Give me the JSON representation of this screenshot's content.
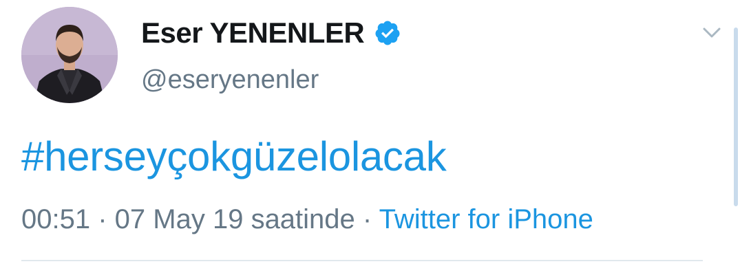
{
  "tweet": {
    "author": {
      "display_name": "Eser YENENLER",
      "handle": "@eseryenenler",
      "verified": true
    },
    "text": "#herseyçokgüzelolacak",
    "time": "00:51",
    "separator": "·",
    "date": "07 May 19 saatinde",
    "source": "Twitter for iPhone"
  },
  "icons": {
    "verified": "verified-badge-icon",
    "menu": "chevron-down-icon"
  },
  "colors": {
    "link": "#1b95e0",
    "muted": "#657786",
    "name": "#14171a",
    "verified": "#1da1f2"
  }
}
